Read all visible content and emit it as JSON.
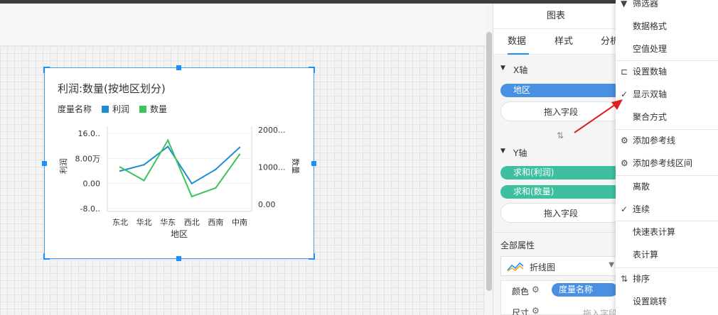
{
  "panel": {
    "title": "图表",
    "tabs": [
      "数据",
      "样式",
      "分析"
    ],
    "x_axis_label": "X轴",
    "x_field": "地区",
    "drop_hint": "拖入字段",
    "swap_icon": "swap-vertical-icon",
    "y_axis_label": "Y轴",
    "y_fields": [
      "求和(利润)",
      "求和(数量)"
    ],
    "all_props": "全部属性",
    "chart_type": "折线图",
    "color_label": "颜色",
    "color_field": "度量名称",
    "size_label": "尺寸",
    "size_hint": "拖入字段"
  },
  "menu": {
    "items": [
      {
        "label": "筛选器",
        "icon": "filter-icon"
      },
      {
        "label": "数据格式",
        "icon": ""
      },
      {
        "label": "空值处理",
        "icon": ""
      },
      {
        "label": "设置数轴",
        "icon": "axis-icon"
      },
      {
        "label": "显示双轴",
        "icon": "check-icon"
      },
      {
        "label": "聚合方式",
        "icon": ""
      },
      {
        "label": "添加参考线",
        "icon": "gear-icon"
      },
      {
        "label": "添加参考线区间",
        "icon": "gear-icon"
      },
      {
        "label": "离散",
        "icon": ""
      },
      {
        "label": "连续",
        "icon": "check-icon"
      },
      {
        "label": "快速表计算",
        "icon": ""
      },
      {
        "label": "表计算",
        "icon": ""
      },
      {
        "label": "排序",
        "icon": "sort-icon"
      },
      {
        "label": "设置跳转",
        "icon": ""
      }
    ]
  },
  "colors": {
    "accent": "#1890ff",
    "pill_blue": "#4a90e2",
    "pill_teal": "#3dbfa0",
    "series_profit": "#1f8dd6",
    "series_qty": "#3cc35a",
    "arrow": "#e02020"
  },
  "chart_data": {
    "type": "line",
    "title": "利润:数量(按地区划分)",
    "legend_title": "度量名称",
    "categories": [
      "东北",
      "华北",
      "华东",
      "西北",
      "西南",
      "中南"
    ],
    "xlabel": "地区",
    "ylabel": "利润",
    "ylabel_right": "数量",
    "yticks_left": [
      "16.0..",
      "8.00万",
      "0.00",
      "-8.0.."
    ],
    "yticks_left_values": [
      160000,
      80000,
      0,
      -80000
    ],
    "yticks_right": [
      "2000...",
      "1000...",
      "0.00"
    ],
    "yticks_right_values": [
      2000,
      1000,
      0
    ],
    "ylim_left": [
      -80000,
      160000
    ],
    "ylim_right": [
      0,
      2000
    ],
    "series": [
      {
        "name": "利润",
        "axis": "left",
        "values": [
          40000,
          60000,
          118000,
          0,
          45000,
          115000
        ]
      },
      {
        "name": "数量",
        "axis": "right",
        "values": [
          1000,
          640,
          1720,
          210,
          440,
          1340
        ]
      }
    ]
  }
}
